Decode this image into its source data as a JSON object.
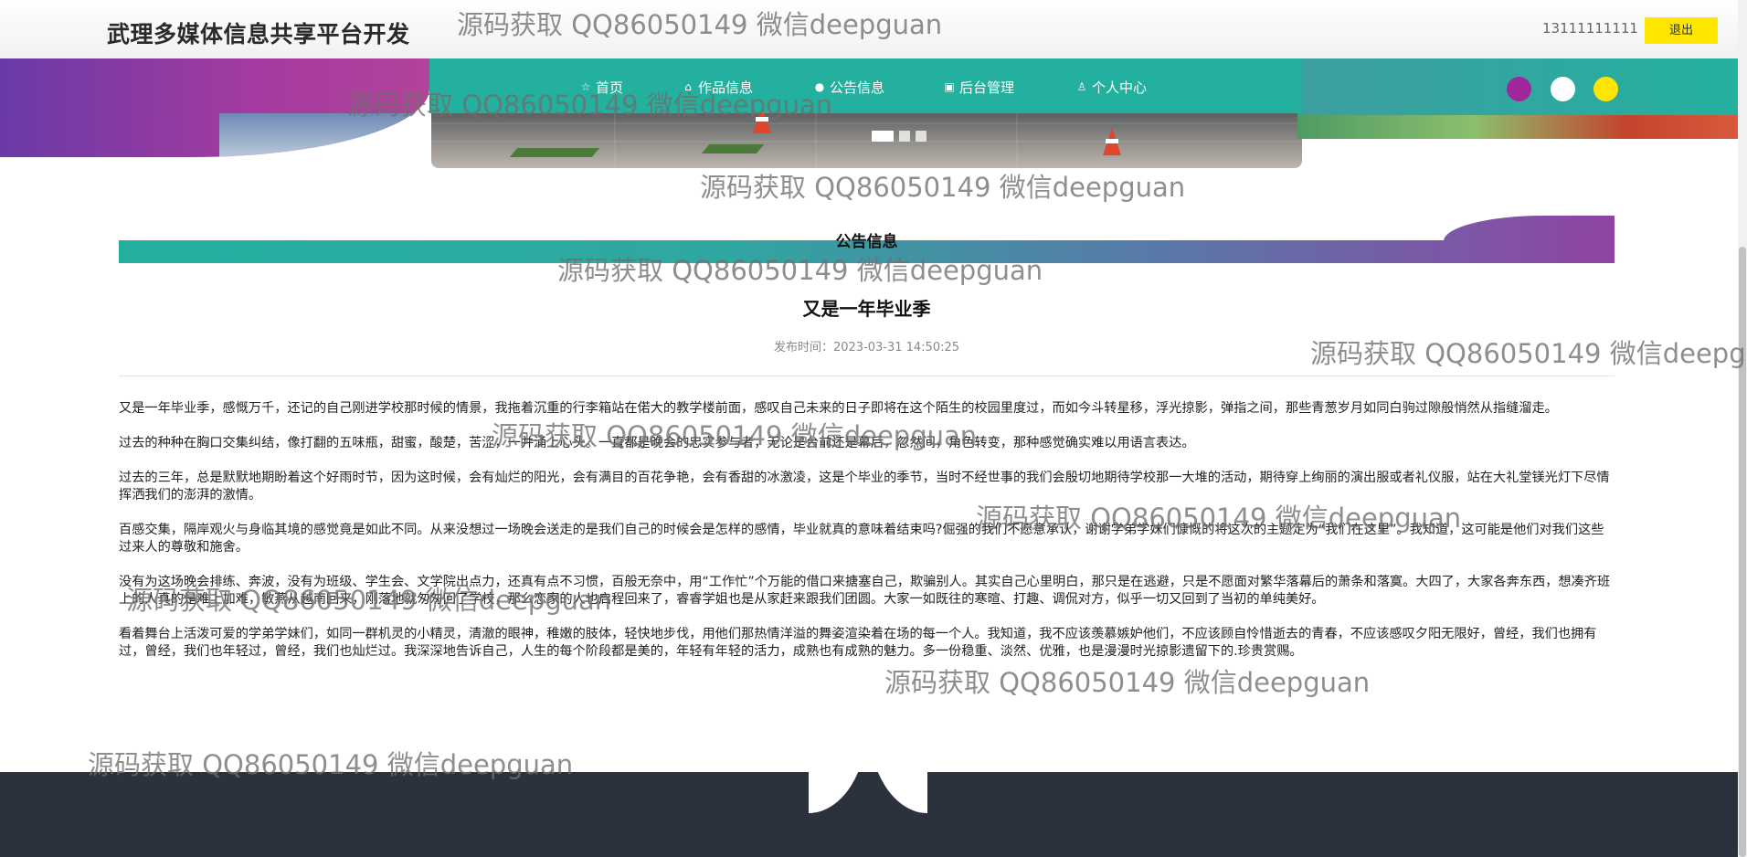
{
  "header": {
    "site_title": "武理多媒体信息共享平台开发",
    "user_phone": "13111111111",
    "logout_label": "退出"
  },
  "nav": {
    "items": [
      {
        "label": "首页",
        "icon": "star-icon",
        "active": true
      },
      {
        "label": "作品信息",
        "icon": "lock-icon",
        "active": false
      },
      {
        "label": "公告信息",
        "icon": "info-icon",
        "active": false
      },
      {
        "label": "后台管理",
        "icon": "briefcase-icon",
        "active": false
      },
      {
        "label": "个人中心",
        "icon": "user-icon",
        "active": false
      }
    ],
    "theme_colors": [
      "#a0279a",
      "#ffffff",
      "#ffe600"
    ]
  },
  "carousel": {
    "slide_count": 3,
    "active_index": 0
  },
  "section": {
    "title": "公告信息"
  },
  "article": {
    "title": "又是一年毕业季",
    "meta": "发布时间：2023-03-31 14:50:25",
    "paragraphs": [
      "又是一年毕业季，感慨万千，还记的自己刚进学校那时候的情景，我拖着沉重的行李箱站在偌大的教学楼前面，感叹自己未来的日子即将在这个陌生的校园里度过，而如今斗转星移，浮光掠影，弹指之间，那些青葱岁月如同白驹过隙般悄然从指缝溜走。",
      "过去的种种在胸口交集纠结，像打翻的五味瓶，甜蜜，酸楚，苦涩，一并涌上心头。一直都是晚会的忠实参与者，无论是台前还是幕后，忽然间，角色转变，那种感觉确实难以用语言表达。",
      "过去的三年，总是默默地期盼着这个好雨时节，因为这时候，会有灿烂的阳光，会有满目的百花争艳，会有香甜的冰激凌，这是个毕业的季节，当时不经世事的我们会殷切地期待学校那一大堆的活动，期待穿上绚丽的演出服或者礼仪服，站在大礼堂镁光灯下尽情挥洒我们的澎湃的激情。",
      "百感交集，隔岸观火与身临其境的感觉竟是如此不同。从来没想过一场晚会送走的是我们自己的时候会是怎样的感情，毕业就真的意味着结束吗?倔强的我们不愿意承认，谢谢学弟学妹们慷慨的将这次的主题定为“我们在这里”。我知道，这可能是他们对我们这些过来人的尊敬和施舍。",
      "没有为这场晚会排练、奔波，没有为班级、学生会、文学院出点力，还真有点不习惯，百般无奈中，用“工作忙”个万能的借口来搪塞自己，欺骗别人。其实自己心里明白，那只是在逃避，只是不愿面对繁华落幕后的萧条和落寞。大四了，大家各奔东西，想凑齐班上的人真的是难上加难，敏燕从越南回来，刚落地就匆匆回了学校，那么恋家的人也启程回来了，睿睿学姐也是从家赶来跟我们团圆。大家一如既往的寒暄、打趣、调侃对方，似乎一切又回到了当初的单纯美好。",
      "看着舞台上活泼可爱的学弟学妹们，如同一群机灵的小精灵，清澈的眼神，稚嫩的肢体，轻快地步伐，用他们那热情洋溢的舞姿渲染着在场的每一个人。我知道，我不应该羡慕嫉妒他们，不应该顾自怜惜逝去的青春，不应该感叹夕阳无限好，曾经，我们也拥有过，曾经，我们也年轻过，曾经，我们也灿烂过。我深深地告诉自己，人生的每个阶段都是美的，年轻有年轻的活力，成熟也有成熟的魅力。多一份稳重、淡然、优雅，也是漫漫时光掠影遗留下的.珍贵赏赐。"
    ]
  },
  "watermark_text": "源码获取 QQ86050149 微信deepguan"
}
